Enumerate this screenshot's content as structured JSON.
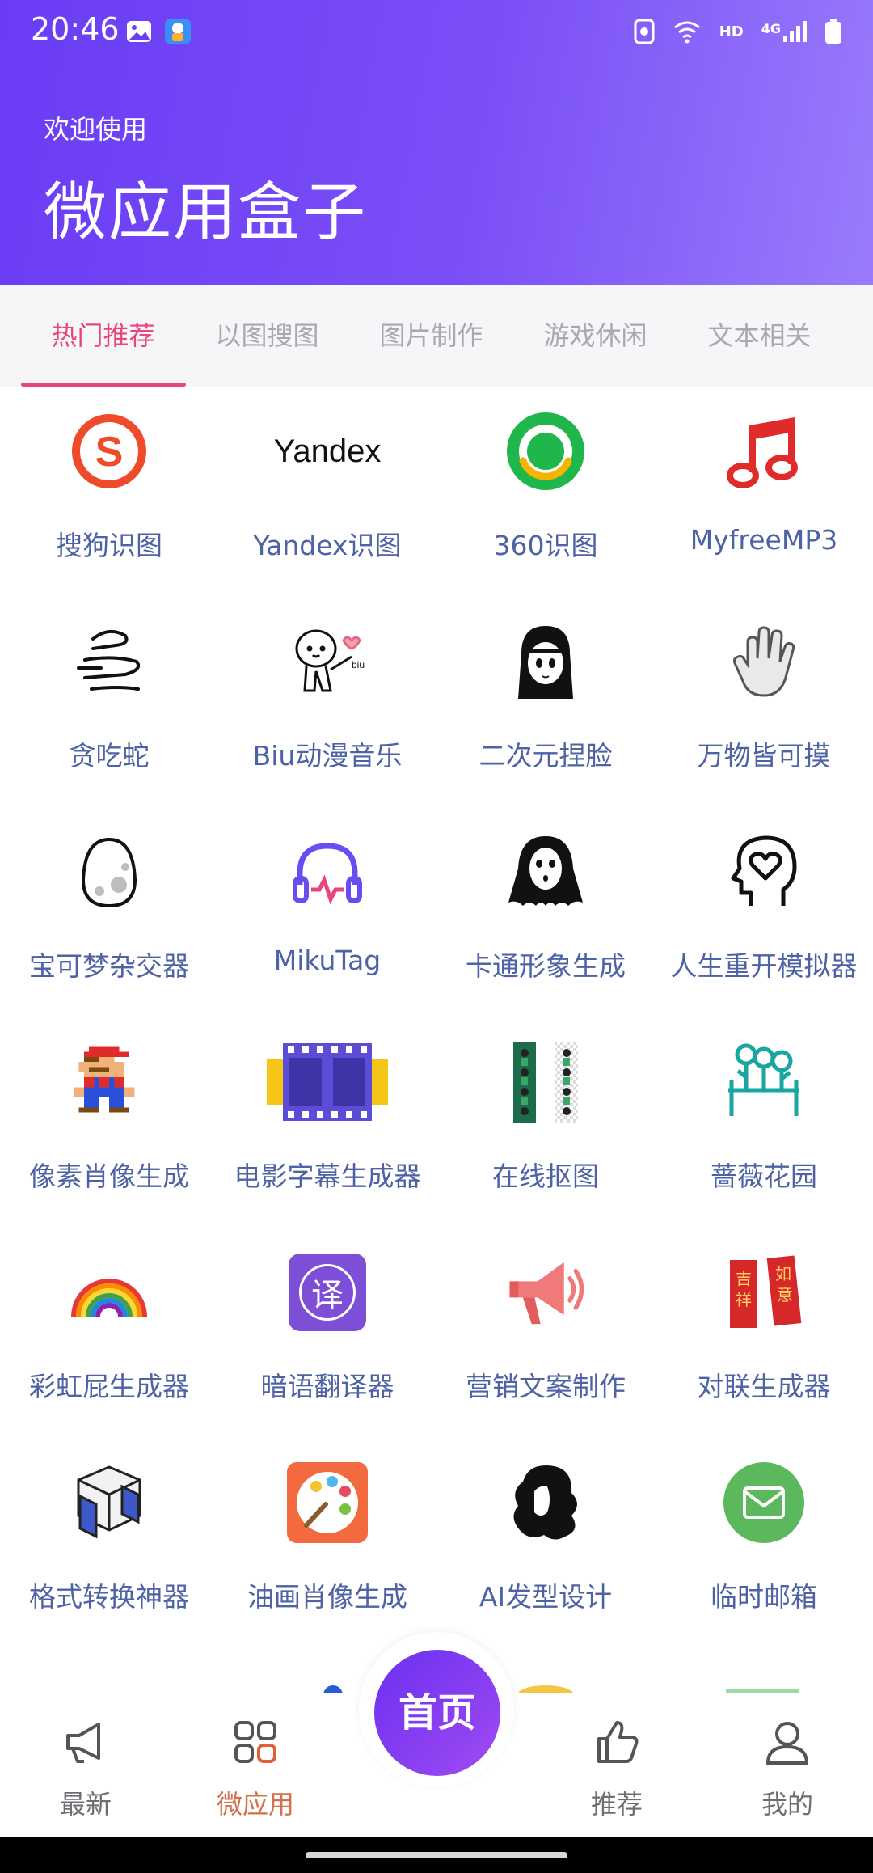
{
  "status_bar": {
    "time": "20:46",
    "network": "HD",
    "signal": "4G"
  },
  "header": {
    "welcome": "欢迎使用",
    "title": "微应用盒子"
  },
  "tabs": [
    {
      "label": "热门推荐",
      "active": true
    },
    {
      "label": "以图搜图",
      "active": false
    },
    {
      "label": "图片制作",
      "active": false
    },
    {
      "label": "游戏休闲",
      "active": false
    },
    {
      "label": "文本相关",
      "active": false
    }
  ],
  "apps": [
    {
      "name": "搜狗识图",
      "icon": "sogou-icon"
    },
    {
      "name": "Yandex识图",
      "icon": "yandex-icon",
      "logo_text": "Yandex"
    },
    {
      "name": "360识图",
      "icon": "360-icon"
    },
    {
      "name": "MyfreeMP3",
      "icon": "music-note-icon"
    },
    {
      "name": "贪吃蛇",
      "icon": "snake-icon"
    },
    {
      "name": "Biu动漫音乐",
      "icon": "anime-character-icon"
    },
    {
      "name": "二次元捏脸",
      "icon": "anime-girl-icon"
    },
    {
      "name": "万物皆可摸",
      "icon": "hand-icon"
    },
    {
      "name": "宝可梦杂交器",
      "icon": "egg-icon"
    },
    {
      "name": "MikuTag",
      "icon": "headphones-icon"
    },
    {
      "name": "卡通形象生成",
      "icon": "ghost-icon"
    },
    {
      "name": "人生重开模拟器",
      "icon": "head-heart-icon"
    },
    {
      "name": "像素肖像生成",
      "icon": "pixel-mario-icon"
    },
    {
      "name": "电影字幕生成器",
      "icon": "film-strip-icon"
    },
    {
      "name": "在线抠图",
      "icon": "image-cutout-icon"
    },
    {
      "name": "蔷薇花园",
      "icon": "garden-icon"
    },
    {
      "name": "彩虹屁生成器",
      "icon": "rainbow-icon"
    },
    {
      "name": "暗语翻译器",
      "icon": "translate-icon",
      "logo_text": "译"
    },
    {
      "name": "营销文案制作",
      "icon": "megaphone-icon"
    },
    {
      "name": "对联生成器",
      "icon": "couplet-icon",
      "logo_text_left": "吉祥",
      "logo_text_right": "如意"
    },
    {
      "name": "格式转换神器",
      "icon": "cube-convert-icon"
    },
    {
      "name": "油画肖像生成",
      "icon": "palette-icon"
    },
    {
      "name": "AI发型设计",
      "icon": "hair-icon"
    },
    {
      "name": "临时邮箱",
      "icon": "mail-icon"
    }
  ],
  "bottom_nav": {
    "latest": "最新",
    "micro_apps": "微应用",
    "home": "首页",
    "recommend": "推荐",
    "mine": "我的"
  },
  "colors": {
    "accent": "#e8457f",
    "header_start": "#6a3cf5",
    "header_end": "#9a7bfb",
    "app_label": "#4e62a6",
    "active_nav": "#d2714c"
  }
}
